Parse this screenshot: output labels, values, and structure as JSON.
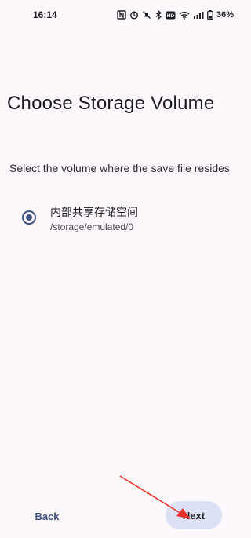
{
  "status_bar": {
    "time": "16:14",
    "battery": "36%",
    "icons": [
      "nfc-icon",
      "alarm-icon",
      "mute-icon",
      "bluetooth-icon",
      "hd-icon",
      "wifi-icon",
      "signal-icon",
      "battery-icon"
    ]
  },
  "page": {
    "title": "Choose Storage Volume",
    "prompt": "Select the volume where the save file resides"
  },
  "options": [
    {
      "name": "内部共享存储空间",
      "path": "/storage/emulated/0",
      "selected": true
    }
  ],
  "footer": {
    "back_label": "Back",
    "next_label": "Next"
  },
  "colors": {
    "accent": "#3f5181",
    "next_button_bg": "#dde1f5",
    "annotation_arrow": "#e8322b"
  }
}
